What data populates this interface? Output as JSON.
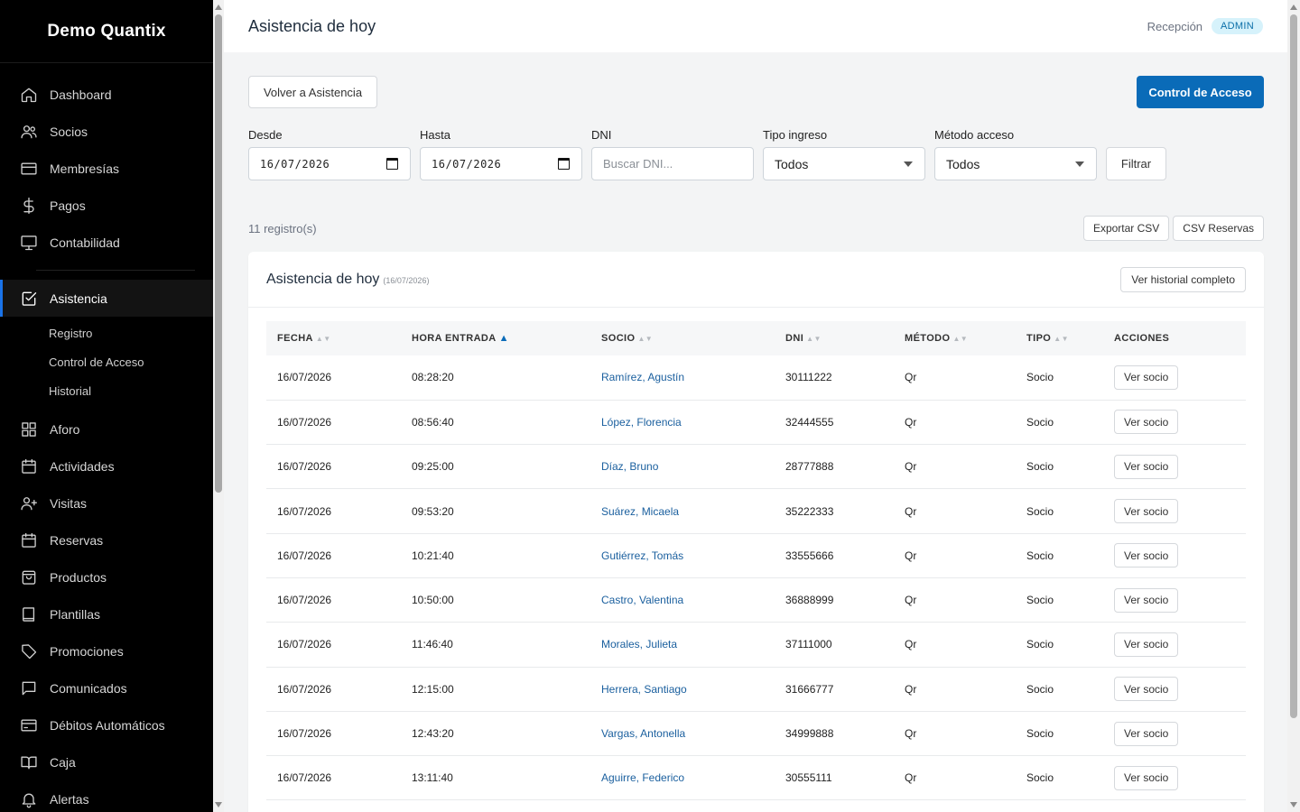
{
  "app": {
    "brand": "Demo Quantix"
  },
  "sidebar": {
    "items_top": [
      {
        "label": "Dashboard",
        "icon": "home-icon"
      },
      {
        "label": "Socios",
        "icon": "users-icon"
      },
      {
        "label": "Membresías",
        "icon": "card-icon"
      },
      {
        "label": "Pagos",
        "icon": "dollar-icon"
      },
      {
        "label": "Contabilidad",
        "icon": "monitor-icon"
      }
    ],
    "active": {
      "label": "Asistencia",
      "icon": "check-square-icon"
    },
    "sub_items": [
      "Registro",
      "Control de Acceso",
      "Historial"
    ],
    "items_bottom": [
      {
        "label": "Aforo",
        "icon": "grid-icon"
      },
      {
        "label": "Actividades",
        "icon": "calendar-icon"
      },
      {
        "label": "Visitas",
        "icon": "user-plus-icon"
      },
      {
        "label": "Reservas",
        "icon": "calendar-icon"
      },
      {
        "label": "Productos",
        "icon": "bag-icon"
      },
      {
        "label": "Plantillas",
        "icon": "book-icon"
      },
      {
        "label": "Promociones",
        "icon": "tag-icon"
      },
      {
        "label": "Comunicados",
        "icon": "message-icon"
      },
      {
        "label": "Débitos Automáticos",
        "icon": "wallet-icon"
      },
      {
        "label": "Caja",
        "icon": "open-book-icon"
      },
      {
        "label": "Alertas",
        "icon": "bell-icon"
      }
    ]
  },
  "header": {
    "title": "Asistencia de hoy",
    "role": "Recepción",
    "badge": "ADMIN"
  },
  "toolbar": {
    "back_label": "Volver a Asistencia",
    "primary_label": "Control de Acceso"
  },
  "filters": {
    "desde": {
      "label": "Desde",
      "value": "16/07/2026"
    },
    "hasta": {
      "label": "Hasta",
      "value": "16/07/2026"
    },
    "dni": {
      "label": "DNI",
      "placeholder": "Buscar DNI..."
    },
    "tipo": {
      "label": "Tipo ingreso",
      "value": "Todos"
    },
    "metodo": {
      "label": "Método acceso",
      "value": "Todos"
    },
    "filter_label": "Filtrar"
  },
  "summary": {
    "count": "11 registro(s)",
    "export_csv": "Exportar CSV",
    "export_reservas": "CSV Reservas"
  },
  "card": {
    "title": "Asistencia de hoy",
    "date": "(16/07/2026)",
    "history_label": "Ver historial completo"
  },
  "table": {
    "columns": [
      "FECHA",
      "HORA ENTRADA",
      "SOCIO",
      "DNI",
      "MÉTODO",
      "TIPO",
      "ACCIONES"
    ],
    "action_label": "Ver socio",
    "rows": [
      {
        "fecha": "16/07/2026",
        "hora": "08:28:20",
        "socio": "Ramírez, Agustín",
        "dni": "30111222",
        "metodo": "Qr",
        "tipo": "Socio"
      },
      {
        "fecha": "16/07/2026",
        "hora": "08:56:40",
        "socio": "López, Florencia",
        "dni": "32444555",
        "metodo": "Qr",
        "tipo": "Socio"
      },
      {
        "fecha": "16/07/2026",
        "hora": "09:25:00",
        "socio": "Díaz, Bruno",
        "dni": "28777888",
        "metodo": "Qr",
        "tipo": "Socio"
      },
      {
        "fecha": "16/07/2026",
        "hora": "09:53:20",
        "socio": "Suárez, Micaela",
        "dni": "35222333",
        "metodo": "Qr",
        "tipo": "Socio"
      },
      {
        "fecha": "16/07/2026",
        "hora": "10:21:40",
        "socio": "Gutiérrez, Tomás",
        "dni": "33555666",
        "metodo": "Qr",
        "tipo": "Socio"
      },
      {
        "fecha": "16/07/2026",
        "hora": "10:50:00",
        "socio": "Castro, Valentina",
        "dni": "36888999",
        "metodo": "Qr",
        "tipo": "Socio"
      },
      {
        "fecha": "16/07/2026",
        "hora": "11:46:40",
        "socio": "Morales, Julieta",
        "dni": "37111000",
        "metodo": "Qr",
        "tipo": "Socio"
      },
      {
        "fecha": "16/07/2026",
        "hora": "12:15:00",
        "socio": "Herrera, Santiago",
        "dni": "31666777",
        "metodo": "Qr",
        "tipo": "Socio"
      },
      {
        "fecha": "16/07/2026",
        "hora": "12:43:20",
        "socio": "Vargas, Antonella",
        "dni": "34999888",
        "metodo": "Qr",
        "tipo": "Socio"
      },
      {
        "fecha": "16/07/2026",
        "hora": "13:11:40",
        "socio": "Aguirre, Federico",
        "dni": "30555111",
        "metodo": "Qr",
        "tipo": "Socio"
      }
    ]
  },
  "colors": {
    "primary": "#0a6bb8",
    "sidebar_bg": "#000000",
    "link": "#1a5f9e",
    "badge_bg": "#d6f2fb"
  }
}
